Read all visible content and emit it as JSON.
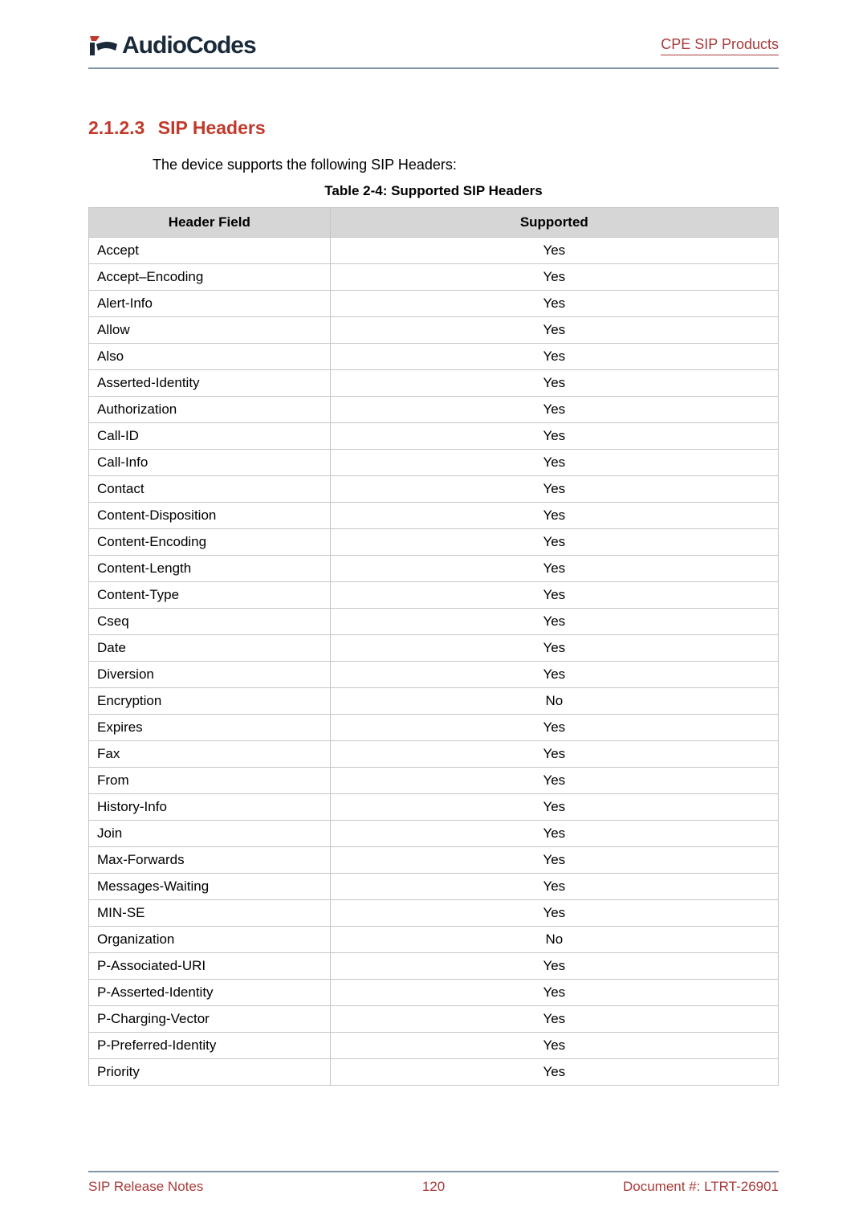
{
  "header": {
    "brand": "AudioCodes",
    "right": "CPE SIP Products"
  },
  "section": {
    "number": "2.1.2.3",
    "title": "SIP Headers",
    "intro": "The device supports the following SIP Headers:",
    "table_caption": "Table 2-4: Supported SIP Headers"
  },
  "table": {
    "columns": {
      "c1": "Header Field",
      "c2": "Supported"
    },
    "rows": [
      {
        "h": "Accept",
        "s": "Yes"
      },
      {
        "h": "Accept–Encoding",
        "s": "Yes"
      },
      {
        "h": "Alert-Info",
        "s": "Yes"
      },
      {
        "h": "Allow",
        "s": "Yes"
      },
      {
        "h": "Also",
        "s": "Yes"
      },
      {
        "h": "Asserted-Identity",
        "s": "Yes"
      },
      {
        "h": "Authorization",
        "s": "Yes"
      },
      {
        "h": "Call-ID",
        "s": "Yes"
      },
      {
        "h": "Call-Info",
        "s": "Yes"
      },
      {
        "h": "Contact",
        "s": "Yes"
      },
      {
        "h": "Content-Disposition",
        "s": "Yes"
      },
      {
        "h": "Content-Encoding",
        "s": "Yes"
      },
      {
        "h": "Content-Length",
        "s": "Yes"
      },
      {
        "h": "Content-Type",
        "s": "Yes"
      },
      {
        "h": "Cseq",
        "s": "Yes"
      },
      {
        "h": "Date",
        "s": "Yes"
      },
      {
        "h": "Diversion",
        "s": "Yes"
      },
      {
        "h": "Encryption",
        "s": "No"
      },
      {
        "h": "Expires",
        "s": "Yes"
      },
      {
        "h": "Fax",
        "s": "Yes"
      },
      {
        "h": "From",
        "s": "Yes"
      },
      {
        "h": "History-Info",
        "s": "Yes"
      },
      {
        "h": "Join",
        "s": "Yes"
      },
      {
        "h": "Max-Forwards",
        "s": "Yes"
      },
      {
        "h": "Messages-Waiting",
        "s": "Yes"
      },
      {
        "h": "MIN-SE",
        "s": "Yes"
      },
      {
        "h": "Organization",
        "s": "No"
      },
      {
        "h": "P-Associated-URI",
        "s": "Yes"
      },
      {
        "h": "P-Asserted-Identity",
        "s": "Yes"
      },
      {
        "h": "P-Charging-Vector",
        "s": "Yes"
      },
      {
        "h": "P-Preferred-Identity",
        "s": "Yes"
      },
      {
        "h": "Priority",
        "s": "Yes"
      }
    ]
  },
  "footer": {
    "left": "SIP Release Notes",
    "center": "120",
    "right": "Document #: LTRT-26901"
  }
}
